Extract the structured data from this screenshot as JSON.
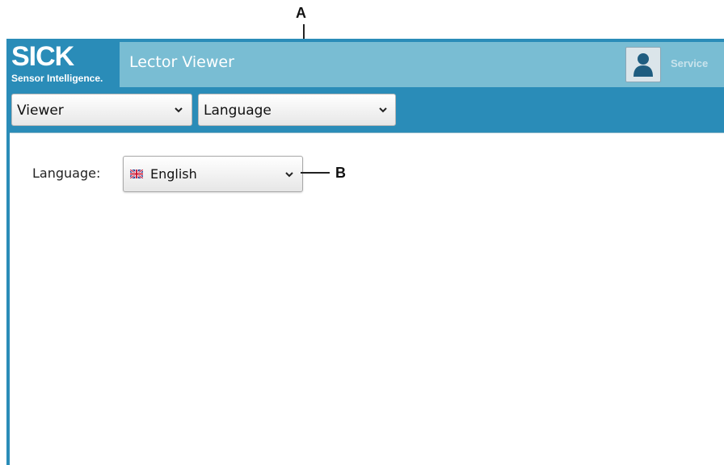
{
  "callouts": {
    "a": "A",
    "b": "B"
  },
  "brand": {
    "name": "SICK",
    "tagline": "Sensor Intelligence."
  },
  "header": {
    "title": "Lector Viewer",
    "user_role": "Service"
  },
  "nav": {
    "view_select": {
      "value": "Viewer"
    },
    "page_select": {
      "value": "Language"
    }
  },
  "content": {
    "language_label": "Language:",
    "language_select": {
      "value": "English",
      "flag_icon": "uk-flag-icon"
    }
  },
  "colors": {
    "header_blue": "#2a8cb8",
    "title_panel": "#79bdd3",
    "content_bg": "#ffffff"
  }
}
